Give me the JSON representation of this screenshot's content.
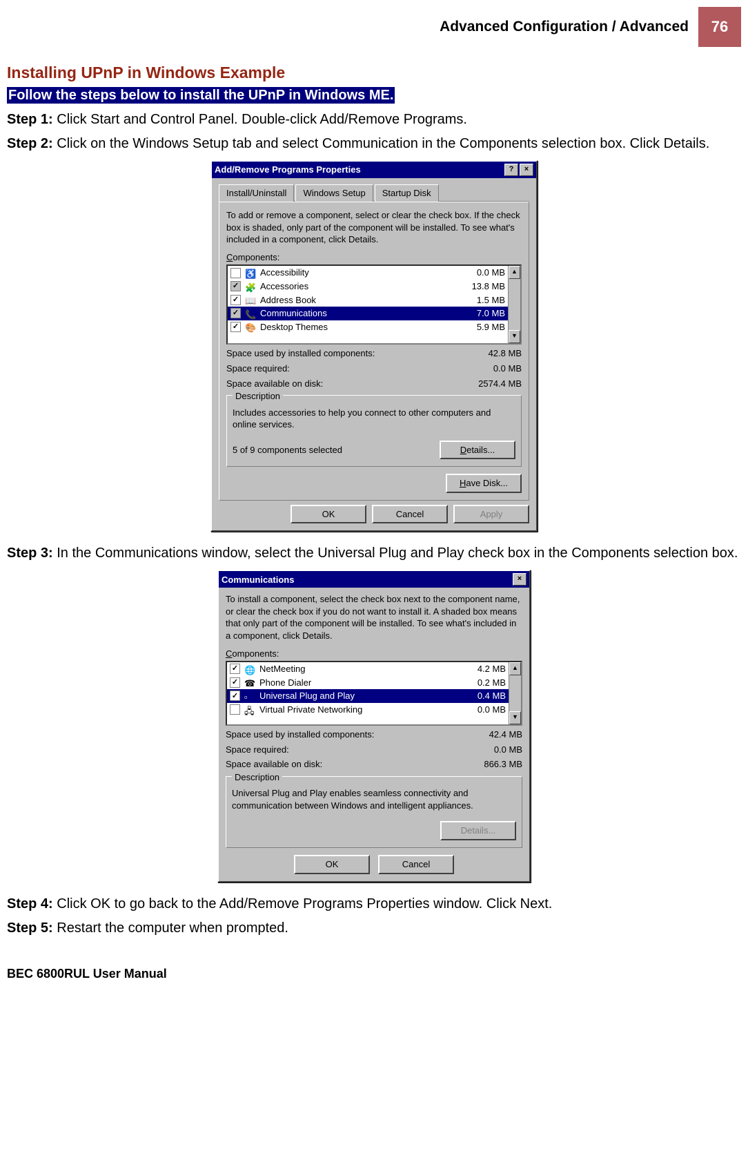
{
  "header": {
    "title": "Advanced Configuration / Advanced",
    "page": "76"
  },
  "section_title": "Installing UPnP in Windows Example",
  "highlight": "Follow the steps below to install the UPnP in Windows ME.",
  "steps": {
    "s1_label": "Step 1:",
    "s1_text": " Click Start and Control Panel. Double-click Add/Remove Programs.",
    "s2_label": "Step 2:",
    "s2_text": " Click on the Windows Setup tab and select Communication in the Components selection box. Click Details.",
    "s3_label": "Step 3:",
    "s3_text": " In the Communications window, select the Universal Plug and Play check box in the Components selection box.",
    "s4_label": "Step 4:",
    "s4_text": " Click OK to go back to the Add/Remove Programs Properties window. Click Next.",
    "s5_label": "Step 5:",
    "s5_text": " Restart the computer when prompted."
  },
  "dlg1": {
    "title": "Add/Remove Programs Properties",
    "tabs": [
      "Install/Uninstall",
      "Windows Setup",
      "Startup Disk"
    ],
    "active_tab": 1,
    "instr": "To add or remove a component, select or clear the check box. If the check box is shaded, only part of the component will be installed. To see what's included in a component, click Details.",
    "components_label": "Components:",
    "rows": [
      {
        "checked": false,
        "gray": false,
        "name": "Accessibility",
        "size": "0.0 MB",
        "sel": false
      },
      {
        "checked": true,
        "gray": true,
        "name": "Accessories",
        "size": "13.8 MB",
        "sel": false
      },
      {
        "checked": true,
        "gray": false,
        "name": "Address Book",
        "size": "1.5 MB",
        "sel": false
      },
      {
        "checked": true,
        "gray": true,
        "name": "Communications",
        "size": "7.0 MB",
        "sel": true
      },
      {
        "checked": true,
        "gray": false,
        "name": "Desktop Themes",
        "size": "5.9 MB",
        "sel": false
      }
    ],
    "space_used_lbl": "Space used by installed components:",
    "space_used": "42.8 MB",
    "space_req_lbl": "Space required:",
    "space_req": "0.0 MB",
    "space_avail_lbl": "Space available on disk:",
    "space_avail": "2574.4 MB",
    "desc_title": "Description",
    "desc_text": "Includes accessories to help you connect to other computers and online services.",
    "subsel": "5 of 9 components selected",
    "btn_details": "Details...",
    "btn_havedisk": "Have Disk...",
    "btn_ok": "OK",
    "btn_cancel": "Cancel",
    "btn_apply": "Apply"
  },
  "dlg2": {
    "title": "Communications",
    "instr": "To install a component, select the check box next to the component name, or clear the check box if you do not want to install it. A shaded box means that only part of the component will be installed. To see what's included in a component, click Details.",
    "components_label": "Components:",
    "rows": [
      {
        "checked": true,
        "gray": false,
        "name": "NetMeeting",
        "size": "4.2 MB",
        "sel": false
      },
      {
        "checked": true,
        "gray": false,
        "name": "Phone Dialer",
        "size": "0.2 MB",
        "sel": false
      },
      {
        "checked": true,
        "gray": false,
        "name": "Universal Plug and Play",
        "size": "0.4 MB",
        "sel": true
      },
      {
        "checked": false,
        "gray": false,
        "name": "Virtual Private Networking",
        "size": "0.0 MB",
        "sel": false
      }
    ],
    "space_used_lbl": "Space used by installed components:",
    "space_used": "42.4 MB",
    "space_req_lbl": "Space required:",
    "space_req": "0.0 MB",
    "space_avail_lbl": "Space available on disk:",
    "space_avail": "866.3 MB",
    "desc_title": "Description",
    "desc_text": "Universal Plug and Play enables seamless connectivity and communication between Windows and intelligent appliances.",
    "btn_details": "Details...",
    "btn_ok": "OK",
    "btn_cancel": "Cancel"
  },
  "footer": "BEC 6800RUL User Manual"
}
